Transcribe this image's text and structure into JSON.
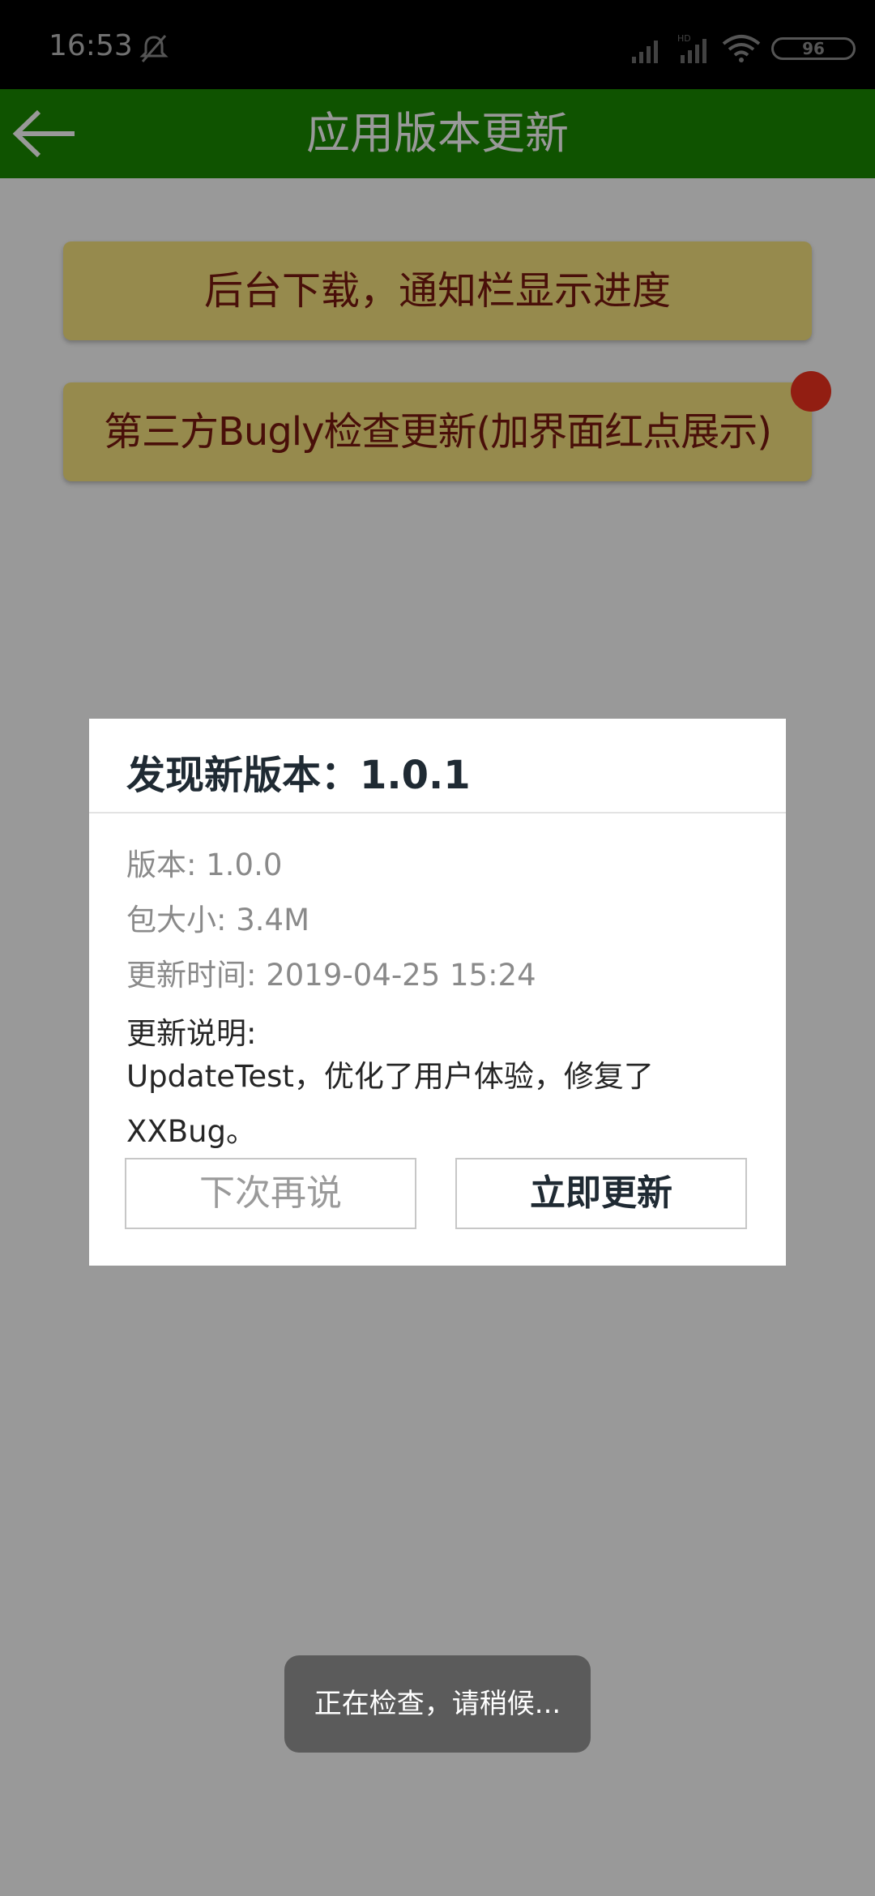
{
  "status_bar": {
    "time": "16:53",
    "battery": "96"
  },
  "toolbar": {
    "title": "应用版本更新"
  },
  "buttons": {
    "background_download": "后台下载，通知栏显示进度",
    "bugly_check": "第三方Bugly检查更新(加界面红点展示)"
  },
  "dialog": {
    "title": "发现新版本：1.0.1",
    "version": "版本: 1.0.0",
    "size": "包大小: 3.4M",
    "update_time": "更新时间: 2019-04-25 15:24",
    "notes_label": "更新说明:",
    "notes_text": "UpdateTest，优化了用户体验，修复了XXBug。",
    "later_button": "下次再说",
    "update_button": "立即更新"
  },
  "toast": {
    "text": "正在检查，请稍候..."
  },
  "colors": {
    "toolbar": "#1a8a00",
    "yellow_button": "#fbe680",
    "button_text": "#7a1a10",
    "red_dot": "#f4321e"
  }
}
